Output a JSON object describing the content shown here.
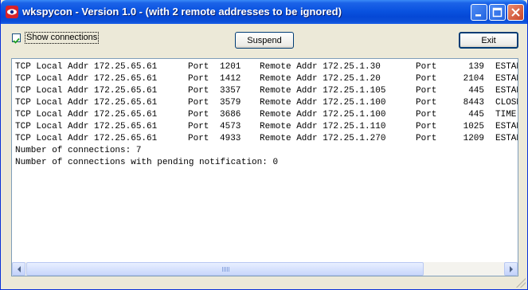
{
  "window": {
    "title": "wkspycon - Version 1.0 - (with 2 remote addresses to be ignored)",
    "icon": "eye-icon"
  },
  "controls": {
    "show_connections_label": "Show connections",
    "show_connections_checked": true,
    "suspend_label": "Suspend",
    "exit_label": "Exit"
  },
  "connections": [
    {
      "proto": "TCP",
      "local_label": "Local Addr",
      "local_addr": "172.25.65.61",
      "port_label": "Port",
      "local_port": "1201",
      "remote_label": "Remote Addr",
      "remote_addr": "172.25.1.30",
      "rport_label": "Port",
      "remote_port": "139",
      "state": "ESTAB"
    },
    {
      "proto": "TCP",
      "local_label": "Local Addr",
      "local_addr": "172.25.65.61",
      "port_label": "Port",
      "local_port": "1412",
      "remote_label": "Remote Addr",
      "remote_addr": "172.25.1.20",
      "rport_label": "Port",
      "remote_port": "2104",
      "state": "ESTAB"
    },
    {
      "proto": "TCP",
      "local_label": "Local Addr",
      "local_addr": "172.25.65.61",
      "port_label": "Port",
      "local_port": "3357",
      "remote_label": "Remote Addr",
      "remote_addr": "172.25.1.105",
      "rport_label": "Port",
      "remote_port": "445",
      "state": "ESTAB"
    },
    {
      "proto": "TCP",
      "local_label": "Local Addr",
      "local_addr": "172.25.65.61",
      "port_label": "Port",
      "local_port": "3579",
      "remote_label": "Remote Addr",
      "remote_addr": "172.25.1.100",
      "rport_label": "Port",
      "remote_port": "8443",
      "state": "CLOSE"
    },
    {
      "proto": "TCP",
      "local_label": "Local Addr",
      "local_addr": "172.25.65.61",
      "port_label": "Port",
      "local_port": "3686",
      "remote_label": "Remote Addr",
      "remote_addr": "172.25.1.100",
      "rport_label": "Port",
      "remote_port": "445",
      "state": "TIME-"
    },
    {
      "proto": "TCP",
      "local_label": "Local Addr",
      "local_addr": "172.25.65.61",
      "port_label": "Port",
      "local_port": "4573",
      "remote_label": "Remote Addr",
      "remote_addr": "172.25.1.110",
      "rport_label": "Port",
      "remote_port": "1025",
      "state": "ESTAB"
    },
    {
      "proto": "TCP",
      "local_label": "Local Addr",
      "local_addr": "172.25.65.61",
      "port_label": "Port",
      "local_port": "4933",
      "remote_label": "Remote Addr",
      "remote_addr": "172.25.1.270",
      "rport_label": "Port",
      "remote_port": "1209",
      "state": "ESTAB"
    }
  ],
  "summary": {
    "count_line": "Number of connections: 7",
    "pending_line": "Number of connections with pending notification: 0"
  },
  "colors": {
    "titlebar": "#0a53e0",
    "window_bg": "#ece9d8",
    "close_button": "#c8452a"
  }
}
